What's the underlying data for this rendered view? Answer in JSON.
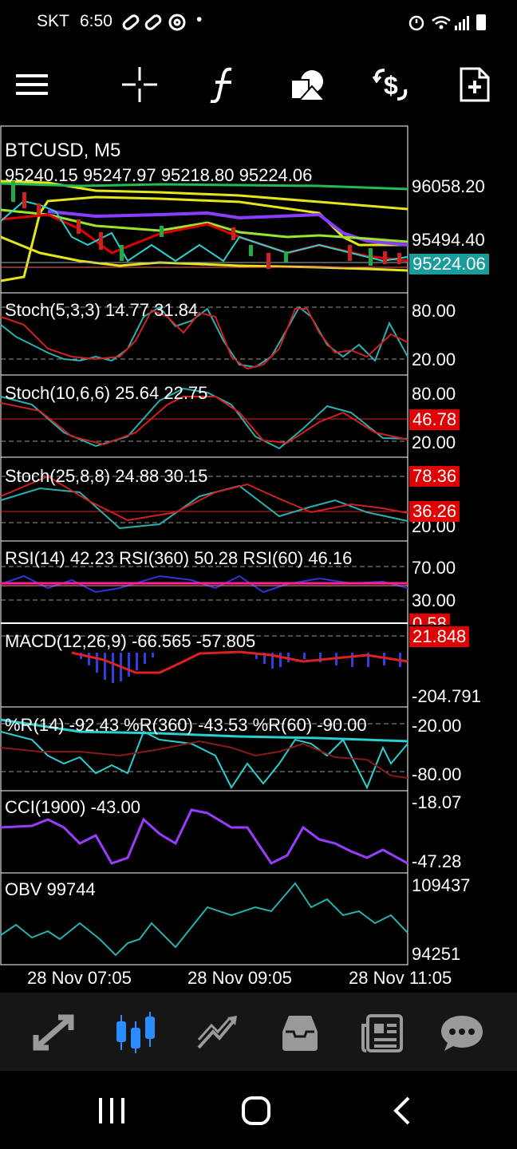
{
  "status_bar": {
    "carrier": "SKT",
    "time": "6:50",
    "dot": "•"
  },
  "toolbar": {
    "icons": [
      "menu-icon",
      "crosshair-icon",
      "function-icon",
      "shapes-icon",
      "trade-icon",
      "new-document-icon"
    ]
  },
  "chart": {
    "symbol": "BTCUSD, M5",
    "ohlc": "95240.15 95247.97 95218.80 95224.06",
    "price_top": "96058.20",
    "price_mid": "95494.40",
    "price_current": "95224.06",
    "current_tag_color": "#1b9c9c",
    "panels": {
      "stoch1": {
        "label": "Stoch(5,3,3) 14.77 31.84",
        "axis_top": "80.00",
        "axis_bottom": "20.00"
      },
      "stoch2": {
        "label": "Stoch(10,6,6) 25.64 22.75",
        "axis_top": "80.00",
        "axis_bottom": "20.00",
        "tag": "46.78"
      },
      "stoch3": {
        "label": "Stoch(25,8,8) 24.88 30.15",
        "tag_top": "78.36",
        "tag_bottom": "36.26",
        "axis_bottom": "20.00"
      },
      "rsi": {
        "label": "RSI(14) 42.23 RSI(360) 50.28 RSI(60) 46.16",
        "axis_top": "70.00",
        "axis_bottom": "30.00",
        "tag_partial": "0.58"
      },
      "macd": {
        "label": "MACD(12,26,9) -66.565 -57.805",
        "tag": "21.848",
        "axis_bottom": "-204.791"
      },
      "wpr": {
        "label": "%R(14) -92.43 %R(360) -43.53 %R(60) -90.00",
        "axis_top": "-20.00",
        "axis_bottom": "-80.00"
      },
      "cci": {
        "label": "CCI(1900) -43.00",
        "axis_top": "-18.07",
        "axis_bottom": "-47.28"
      },
      "obv": {
        "label": "OBV 99744",
        "axis_top": "109437",
        "axis_bottom": "94251"
      }
    },
    "time_axis": [
      "28 Nov 07:05",
      "28 Nov 09:05",
      "28 Nov 11:05"
    ],
    "tag_color": "#e00000"
  },
  "bottom_nav": {
    "items": [
      "quotes-icon",
      "chart-icon",
      "trade-icon",
      "history-icon",
      "news-icon",
      "messages-icon"
    ],
    "active": "chart-icon",
    "active_color": "#2a8cff"
  },
  "system_nav": [
    "recents-icon",
    "home-icon",
    "back-icon"
  ]
}
